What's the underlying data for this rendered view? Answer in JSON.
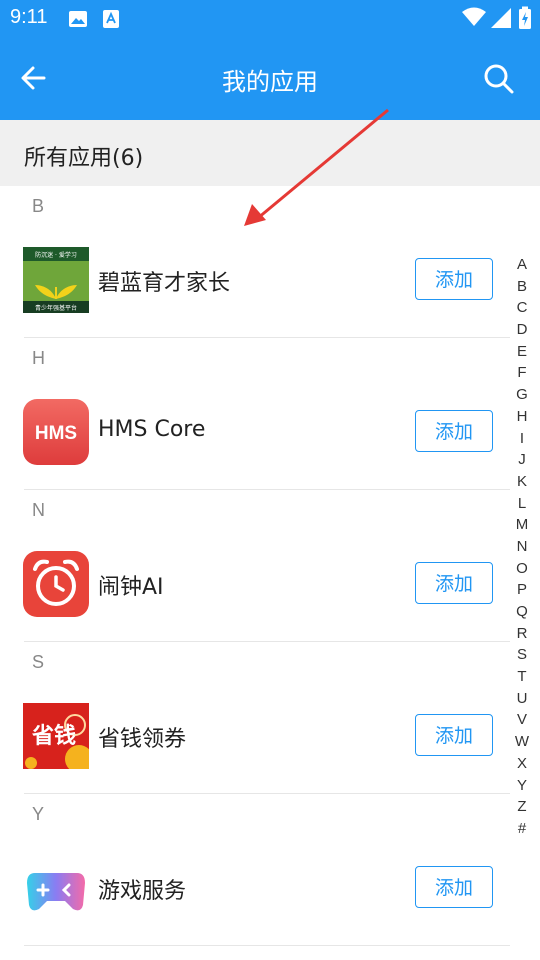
{
  "status_bar": {
    "time": "9:11"
  },
  "app_bar": {
    "title": "我的应用"
  },
  "section": {
    "label": "所有应用(6)"
  },
  "groups": [
    {
      "letter": "B",
      "app": {
        "name": "碧蓝育才家长",
        "button": "添加",
        "icon_lines": [
          "防沉迷 · 爱学习",
          "青少年强基平台"
        ]
      }
    },
    {
      "letter": "H",
      "app": {
        "name": "HMS Core",
        "button": "添加",
        "icon_text": "HMS"
      }
    },
    {
      "letter": "N",
      "app": {
        "name": "闹钟AI",
        "button": "添加"
      }
    },
    {
      "letter": "S",
      "app": {
        "name": "省钱领券",
        "button": "添加",
        "icon_text": "省钱"
      }
    },
    {
      "letter": "Y",
      "app": {
        "name": "游戏服务",
        "button": "添加"
      }
    }
  ],
  "alphabet": [
    "A",
    "B",
    "C",
    "D",
    "E",
    "F",
    "G",
    "H",
    "I",
    "J",
    "K",
    "L",
    "M",
    "N",
    "O",
    "P",
    "Q",
    "R",
    "S",
    "T",
    "U",
    "V",
    "W",
    "X",
    "Y",
    "Z",
    "#"
  ],
  "colors": {
    "primary": "#2196f3",
    "annotation_arrow": "#e53935"
  }
}
